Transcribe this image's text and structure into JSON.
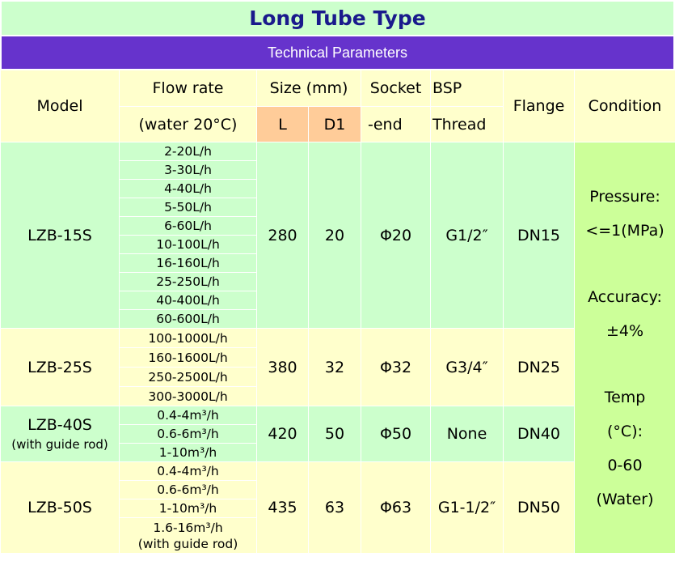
{
  "title": "Long Tube Type",
  "subtitle": "Technical Parameters",
  "headers": {
    "model": "Model",
    "flow_rate_1": "Flow rate",
    "flow_rate_2": "(water 20°C)",
    "size": "Size (mm)",
    "size_l": "L",
    "size_d1": "D1",
    "socket_1": "Socket",
    "socket_2": "-end",
    "bsp_1": "BSP",
    "bsp_2": "Thread",
    "flange": "Flange",
    "condition": "Condition"
  },
  "condition": {
    "pressure_label": "Pressure:",
    "pressure_value": "<=1(MPa)",
    "accuracy_label": "Accuracy:",
    "accuracy_value": "±4%",
    "temp_label": "Temp",
    "temp_unit": "(°C):",
    "temp_value": "0-60",
    "temp_medium": "(Water)"
  },
  "rows": [
    {
      "model": "LZB-15S",
      "model_note": "",
      "flows": [
        "2-20L/h",
        "3-30L/h",
        "4-40L/h",
        "5-50L/h",
        "6-60L/h",
        "10-100L/h",
        "16-160L/h",
        "25-250L/h",
        "40-400L/h",
        "60-600L/h"
      ],
      "l": "280",
      "d1": "20",
      "socket": "Φ20",
      "bsp": "G1/2″",
      "flange": "DN15"
    },
    {
      "model": "LZB-25S",
      "model_note": "",
      "flows": [
        "100-1000L/h",
        "160-1600L/h",
        "250-2500L/h",
        "300-3000L/h"
      ],
      "l": "380",
      "d1": "32",
      "socket": "Φ32",
      "bsp": "G3/4″",
      "flange": "DN25"
    },
    {
      "model": "LZB-40S",
      "model_note": "(with guide rod)",
      "flows": [
        "0.4-4m³/h",
        "0.6-6m³/h",
        "1-10m³/h"
      ],
      "l": "420",
      "d1": "50",
      "socket": "Φ50",
      "bsp": "None",
      "flange": "DN40"
    },
    {
      "model": "LZB-50S",
      "model_note": "",
      "flows": [
        "0.4-4m³/h",
        "0.6-6m³/h",
        "1-10m³/h",
        "1.6-16m³/h"
      ],
      "flow_last_note": "(with guide rod)",
      "l": "435",
      "d1": "63",
      "socket": "Φ63",
      "bsp": "G1-1/2″",
      "flange": "DN50"
    }
  ]
}
